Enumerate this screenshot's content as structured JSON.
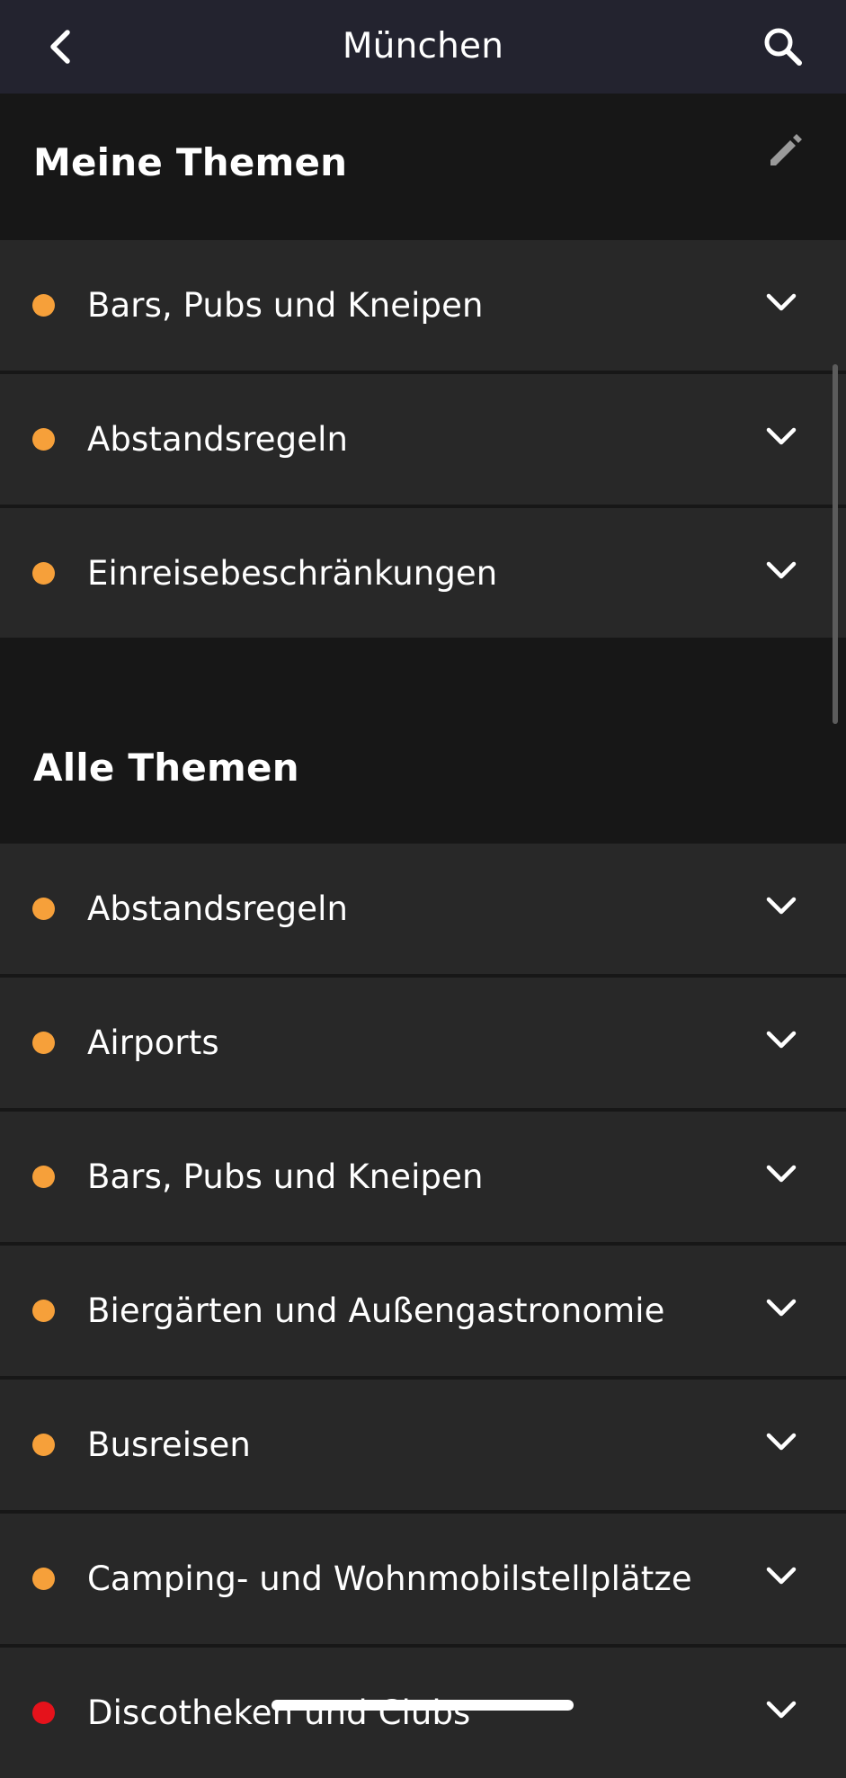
{
  "header": {
    "title": "München"
  },
  "icons": {
    "back": "chevron-left-icon",
    "search": "search-icon",
    "edit": "pencil-icon",
    "expand": "chevron-down-icon"
  },
  "colors": {
    "background": "#171717",
    "header_bg": "#23232f",
    "row_bg": "#282828",
    "status_orange": "#f6a03a",
    "status_red": "#e5121b"
  },
  "my_topics": {
    "title": "Meine Themen",
    "items": [
      {
        "label": "Bars, Pubs und Kneipen",
        "status": "orange"
      },
      {
        "label": "Abstandsregeln",
        "status": "orange"
      },
      {
        "label": "Einreisebeschränkungen",
        "status": "orange"
      }
    ]
  },
  "all_topics": {
    "title": "Alle Themen",
    "items": [
      {
        "label": "Abstandsregeln",
        "status": "orange"
      },
      {
        "label": "Airports",
        "status": "orange"
      },
      {
        "label": "Bars, Pubs und Kneipen",
        "status": "orange"
      },
      {
        "label": "Biergärten und Außengastronomie",
        "status": "orange"
      },
      {
        "label": "Busreisen",
        "status": "orange"
      },
      {
        "label": "Camping- und Wohnmobilstellplätze",
        "status": "orange"
      },
      {
        "label": "Discotheken und Clubs",
        "status": "red"
      }
    ]
  }
}
